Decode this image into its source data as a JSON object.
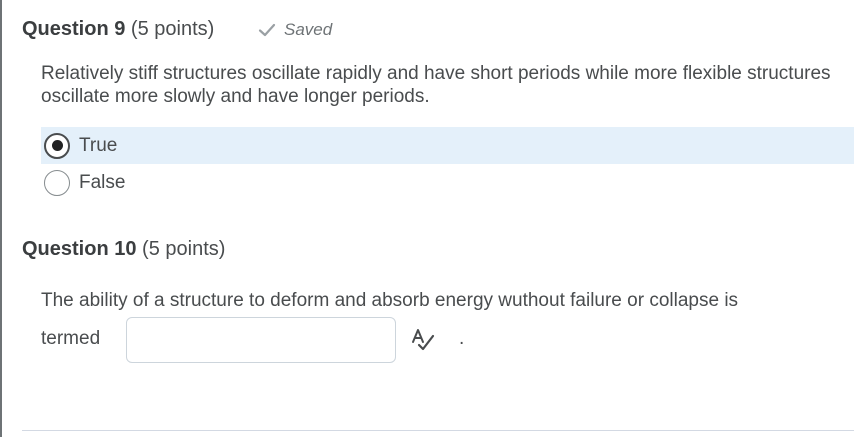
{
  "question9": {
    "title": "Question 9",
    "points": "(5 points)",
    "saved_label": "Saved",
    "text": "Relatively stiff structures oscillate rapidly and have short periods while more flexible structures oscillate more slowly and have longer periods.",
    "options": [
      {
        "label": "True",
        "selected": true
      },
      {
        "label": "False",
        "selected": false
      }
    ]
  },
  "question10": {
    "title": "Question 10",
    "points": "(5 points)",
    "text_before": "The ability of a structure to deform and absorb energy wuthout failure or collapse is",
    "text_termed": "termed",
    "answer_value": "",
    "text_after": "."
  },
  "icons": {
    "saved": "check-icon",
    "spellcheck": "spellcheck-icon"
  },
  "colors": {
    "selected_bg": "#e4f0fa",
    "text": "#494c4e"
  }
}
